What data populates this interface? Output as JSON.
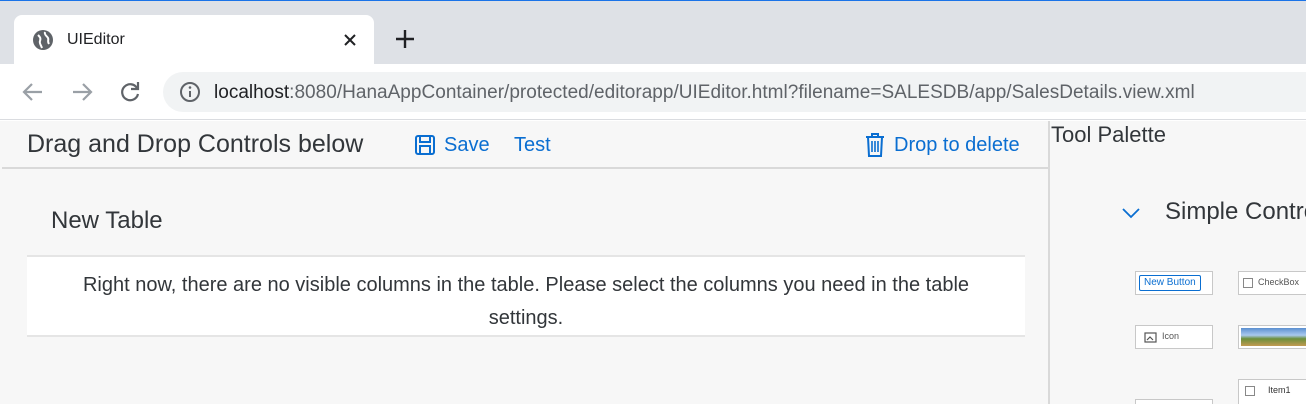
{
  "browser": {
    "tab_title": "UIEditor",
    "url_host": "localhost",
    "url_rest": ":8080/HanaAppContainer/protected/editorapp/UIEditor.html?filename=SALESDB/app/SalesDetails.view.xml"
  },
  "toolbar": {
    "title": "Drag and Drop Controls below",
    "save_label": "Save",
    "test_label": "Test",
    "delete_label": "Drop to delete"
  },
  "table": {
    "title": "New Table",
    "no_columns_message": "Right now, there are no visible columns in the table. Please select the columns you need in the table settings."
  },
  "palette": {
    "title": "Tool Palette",
    "section_title": "Simple Contro",
    "controls": {
      "button_label": "New Button",
      "checkbox_label": "CheckBox",
      "icon_label": "Icon",
      "list_item_label": "Item1"
    }
  },
  "colors": {
    "accent": "#0a6ed1",
    "text": "#32363a",
    "background": "#f7f7f7"
  }
}
